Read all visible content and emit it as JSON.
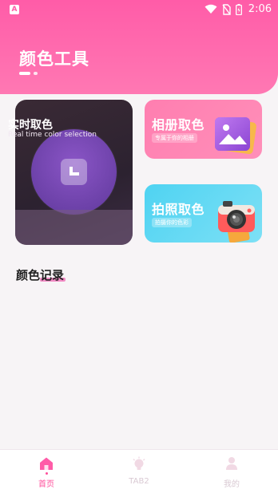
{
  "status_bar": {
    "app_icon": "A",
    "time": "2:06",
    "icons": [
      "wifi-icon",
      "no-sim-icon",
      "battery-icon"
    ]
  },
  "header": {
    "title": "颜色工具"
  },
  "cards": {
    "realtime": {
      "title": "实时取色",
      "subtitle": "Real time color selection"
    },
    "album": {
      "title": "相册取色",
      "subtitle": "专属于你的相册"
    },
    "photo": {
      "title": "拍照取色",
      "subtitle": "拍摄你的色彩"
    }
  },
  "records": {
    "title_part1": "颜色",
    "title_part2": "记录"
  },
  "tabbar": {
    "tabs": [
      {
        "label": "首页",
        "icon": "home-icon",
        "active": true
      },
      {
        "label": "TAB2",
        "icon": "lightbulb-icon",
        "active": false
      },
      {
        "label": "我的",
        "icon": "user-icon",
        "active": false
      }
    ]
  },
  "colors": {
    "accent": "#ff5ca8",
    "album_card": "#ff8fb9",
    "photo_card": "#5fd6f3",
    "realtime_circle": "#7a4bb8"
  }
}
